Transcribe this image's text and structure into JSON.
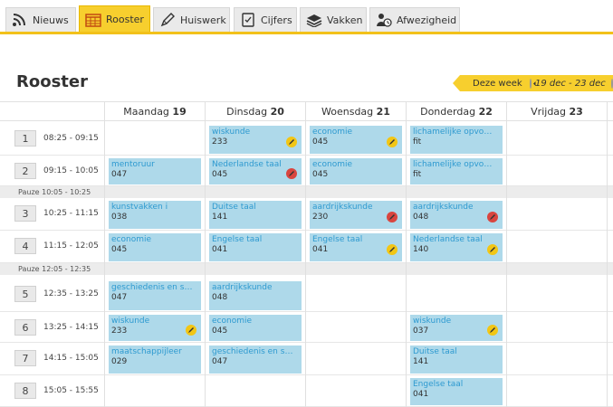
{
  "tabs": [
    {
      "label": "Nieuws",
      "icon": "rss-icon",
      "active": false
    },
    {
      "label": "Rooster",
      "icon": "calendar-icon",
      "active": true
    },
    {
      "label": "Huiswerk",
      "icon": "pencil-icon",
      "active": false
    },
    {
      "label": "Cijfers",
      "icon": "document-check-icon",
      "active": false
    },
    {
      "label": "Vakken",
      "icon": "books-icon",
      "active": false
    },
    {
      "label": "Afwezigheid",
      "icon": "user-clock-icon",
      "active": false
    }
  ],
  "page_title": "Rooster",
  "week": {
    "label": "Deze week",
    "range": "19 dec - 23 dec"
  },
  "days": [
    {
      "name": "Maandag",
      "num": "19"
    },
    {
      "name": "Dinsdag",
      "num": "20"
    },
    {
      "name": "Woensdag",
      "num": "21"
    },
    {
      "name": "Donderdag",
      "num": "22"
    },
    {
      "name": "Vrijdag",
      "num": "23"
    }
  ],
  "hours": [
    {
      "n": "1",
      "time": "08:25 - 09:15"
    },
    {
      "n": "2",
      "time": "09:15 - 10:05"
    },
    {
      "n": "3",
      "time": "10:25 - 11:15"
    },
    {
      "n": "4",
      "time": "11:15 - 12:05"
    },
    {
      "n": "5",
      "time": "12:35 - 13:25"
    },
    {
      "n": "6",
      "time": "13:25 - 14:15"
    },
    {
      "n": "7",
      "time": "14:15 - 15:05"
    },
    {
      "n": "8",
      "time": "15:05 - 15:55"
    }
  ],
  "pauses": [
    {
      "label": "Pauze",
      "time": "10:05 - 10:25"
    },
    {
      "label": "Pauze",
      "time": "12:05 - 12:35"
    }
  ],
  "lessons": [
    {
      "hour": 1,
      "day": 1,
      "subject": "wiskunde",
      "room": "233",
      "badge": "yellow"
    },
    {
      "hour": 1,
      "day": 2,
      "subject": "economie",
      "room": "045",
      "badge": "yellow"
    },
    {
      "hour": 1,
      "day": 3,
      "subject": "lichamelijke opvoeding",
      "room": "fit",
      "badge": ""
    },
    {
      "hour": 2,
      "day": 0,
      "subject": "mentoruur",
      "room": "047",
      "badge": ""
    },
    {
      "hour": 2,
      "day": 1,
      "subject": "Nederlandse taal",
      "room": "045",
      "badge": "red"
    },
    {
      "hour": 2,
      "day": 2,
      "subject": "economie",
      "room": "045",
      "badge": ""
    },
    {
      "hour": 2,
      "day": 3,
      "subject": "lichamelijke opvoeding",
      "room": "fit",
      "badge": ""
    },
    {
      "hour": 3,
      "day": 0,
      "subject": "kunstvakken i",
      "room": "038",
      "badge": ""
    },
    {
      "hour": 3,
      "day": 1,
      "subject": "Duitse taal",
      "room": "141",
      "badge": ""
    },
    {
      "hour": 3,
      "day": 2,
      "subject": "aardrijkskunde",
      "room": "230",
      "badge": "red"
    },
    {
      "hour": 3,
      "day": 3,
      "subject": "aardrijkskunde",
      "room": "048",
      "badge": "red"
    },
    {
      "hour": 4,
      "day": 0,
      "subject": "economie",
      "room": "045",
      "badge": ""
    },
    {
      "hour": 4,
      "day": 1,
      "subject": "Engelse taal",
      "room": "041",
      "badge": ""
    },
    {
      "hour": 4,
      "day": 2,
      "subject": "Engelse taal",
      "room": "041",
      "badge": "yellow"
    },
    {
      "hour": 4,
      "day": 3,
      "subject": "Nederlandse taal",
      "room": "140",
      "badge": "yellow"
    },
    {
      "hour": 5,
      "day": 0,
      "subject": "geschiedenis en staa...",
      "room": "047",
      "badge": ""
    },
    {
      "hour": 5,
      "day": 1,
      "subject": "aardrijkskunde",
      "room": "048",
      "badge": ""
    },
    {
      "hour": 6,
      "day": 0,
      "subject": "wiskunde",
      "room": "233",
      "badge": "yellow"
    },
    {
      "hour": 6,
      "day": 1,
      "subject": "economie",
      "room": "045",
      "badge": ""
    },
    {
      "hour": 6,
      "day": 3,
      "subject": "wiskunde",
      "room": "037",
      "badge": "yellow"
    },
    {
      "hour": 7,
      "day": 0,
      "subject": "maatschappijleer",
      "room": "029",
      "badge": ""
    },
    {
      "hour": 7,
      "day": 1,
      "subject": "geschiedenis en staa...",
      "room": "047",
      "badge": ""
    },
    {
      "hour": 7,
      "day": 3,
      "subject": "Duitse taal",
      "room": "141",
      "badge": ""
    },
    {
      "hour": 8,
      "day": 3,
      "subject": "Engelse taal",
      "room": "041",
      "badge": ""
    }
  ],
  "colors": {
    "accent": "#f7cf2e",
    "lesson_bg": "#aed9ea",
    "subject_text": "#2e9ad0",
    "badge_yellow": "#f2c615",
    "badge_red": "#d9453f"
  }
}
